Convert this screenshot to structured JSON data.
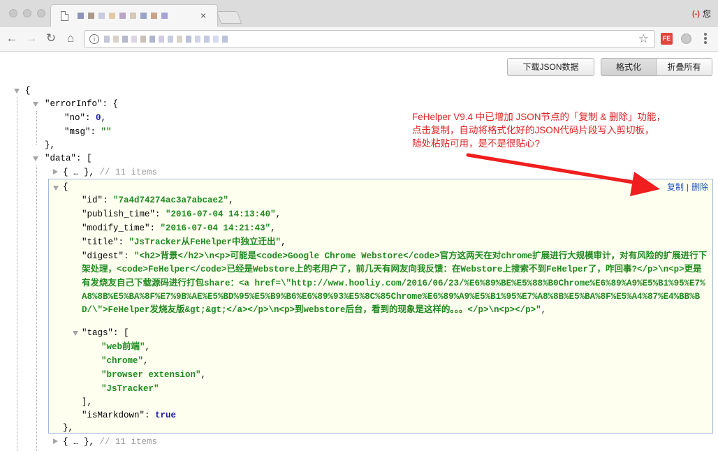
{
  "browser": {
    "tab_title": "",
    "address_url": "",
    "profile_label": "您",
    "profile_glyph": "(-)",
    "close_glyph": "×",
    "extension_label": "FE"
  },
  "actions": {
    "download_json": "下载JSON数据",
    "format": "格式化",
    "fold_all": "折叠所有"
  },
  "annotation": {
    "lines": [
      "FeHelper V9.4 中已增加 JSON节点的「复制 & 删除」功能，",
      "点击复制，自动将格式化好的JSON代码片段写入剪切板，",
      "随处粘贴可用，是不是很贴心?"
    ],
    "color": "#e02424"
  },
  "node_actions": {
    "copy": "复制",
    "separator": "|",
    "delete": "删除"
  },
  "json": {
    "errorInfo_key": "\"errorInfo\"",
    "no_key": "\"no\"",
    "no_value": "0",
    "msg_key": "\"msg\"",
    "msg_value": "\"\"",
    "data_key": "\"data\"",
    "collapsed_item": "{ … },",
    "collapsed_comment": "// 11 items",
    "item": {
      "id_key": "\"id\"",
      "id_value": "\"7a4d74274ac3a7abcae2\"",
      "publish_time_key": "\"publish_time\"",
      "publish_time_value": "\"2016-07-04 14:13:40\"",
      "modify_time_key": "\"modify_time\"",
      "modify_time_value": "\"2016-07-04 14:21:43\"",
      "title_key": "\"title\"",
      "title_value": "\"JsTracker从FeHelper中独立迁出\"",
      "digest_key": "\"digest\"",
      "digest_value": "\"<h2>背景</h2>\\n<p>可能是<code>Google Chrome Webstore</code>官方这两天在对chrome扩展进行大规模审计，对有风险的扩展进行下架处理，<code>FeHelper</code>已经是Webstore上的老用户了，前几天有网友向我反馈：在Webstore上搜索不到FeHelper了，咋回事?</p>\\n<p>更是有发烧友自己下载源码进行打包share：<a href=\\\"http://www.hooliy.com/2016/06/23/%E6%89%BE%E5%88%B0Chrome%E6%89%A9%E5%B1%95%E7%A8%8B%E5%BA%8F%E7%9B%AE%E5%BD%95%E5%B9%B6%E6%89%93%E5%8C%85Chrome%E6%89%A9%E5%B1%95%E7%A8%8B%E5%BA%8F%E5%A4%87%E4%BB%BD/\\\">FeHelper发烧友版&gt;&gt;</a></p>\\n<p>到webstore后台，看到的现象是这样的。。。</p>\\n<p></p>\"",
      "tags_key": "\"tags\"",
      "tags": [
        "\"web前端\"",
        "\"chrome\"",
        "\"browser extension\"",
        "\"JsTracker\""
      ],
      "isMarkdown_key": "\"isMarkdown\"",
      "isMarkdown_value": "true"
    }
  }
}
